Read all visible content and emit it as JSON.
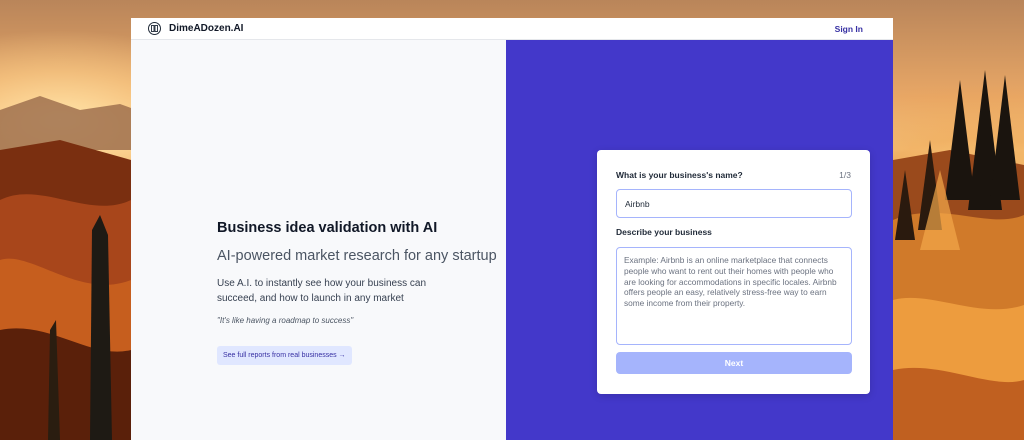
{
  "header": {
    "brand": "DimeADozen.AI",
    "signin": "Sign In"
  },
  "hero": {
    "title": "Business idea validation with AI",
    "subtitle": "AI-powered market research for any startup",
    "description": "Use A.I. to instantly see how your business can succeed, and how to launch in any market",
    "quote": "\"It's like having a roadmap to success\"",
    "reports_button": "See full reports from real businesses →"
  },
  "form": {
    "question_name": "What is your business's name?",
    "step": "1/3",
    "name_value": "Airbnb",
    "question_description": "Describe your business",
    "description_placeholder": "Example: Airbnb is an online marketplace that connects people who want to rent out their homes with people who are looking for accommodations in specific locales. Airbnb offers people an easy, relatively stress-free way to earn some income from their property.",
    "next_button": "Next"
  },
  "colors": {
    "accent": "#4338ca",
    "button_disabled": "#a5b4fc",
    "link": "#3730a3"
  }
}
